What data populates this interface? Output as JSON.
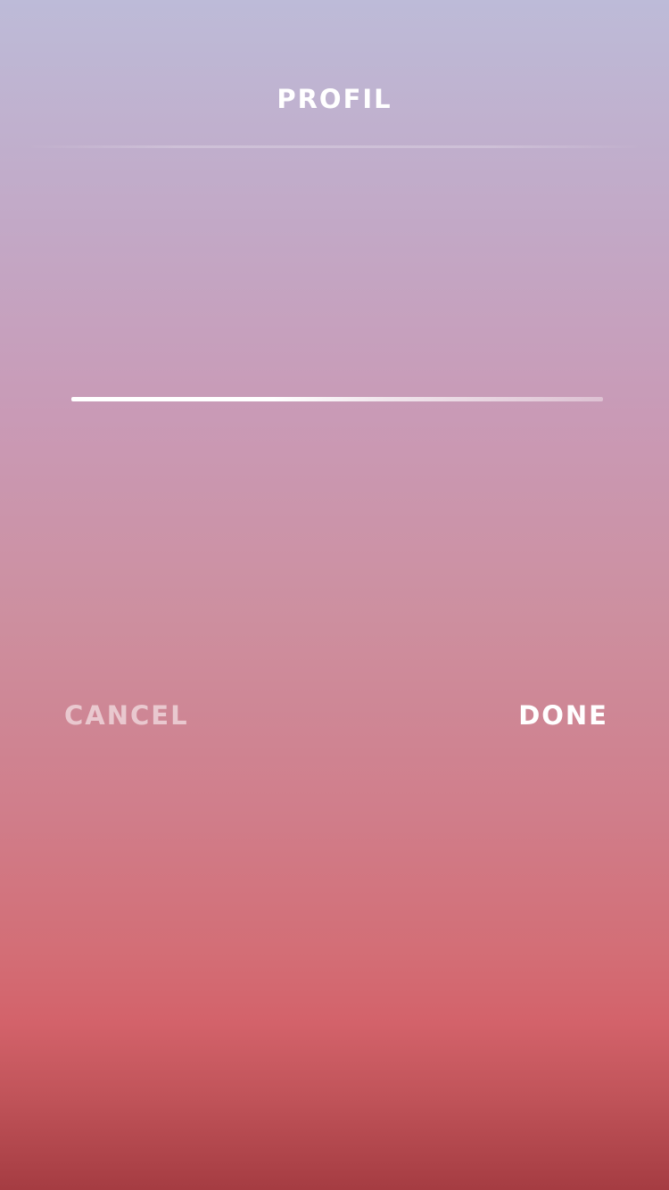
{
  "header": {
    "title": "PROFIL"
  },
  "form": {
    "name_value": "",
    "name_placeholder": ""
  },
  "actions": {
    "cancel_label": "CANCEL",
    "done_label": "DONE"
  },
  "colors": {
    "gradient_top": "#bdbbd8",
    "gradient_mid": "#cd8f9f",
    "gradient_low": "#d3626a",
    "gradient_bottom": "#a53c42",
    "text_primary": "#ffffff"
  }
}
